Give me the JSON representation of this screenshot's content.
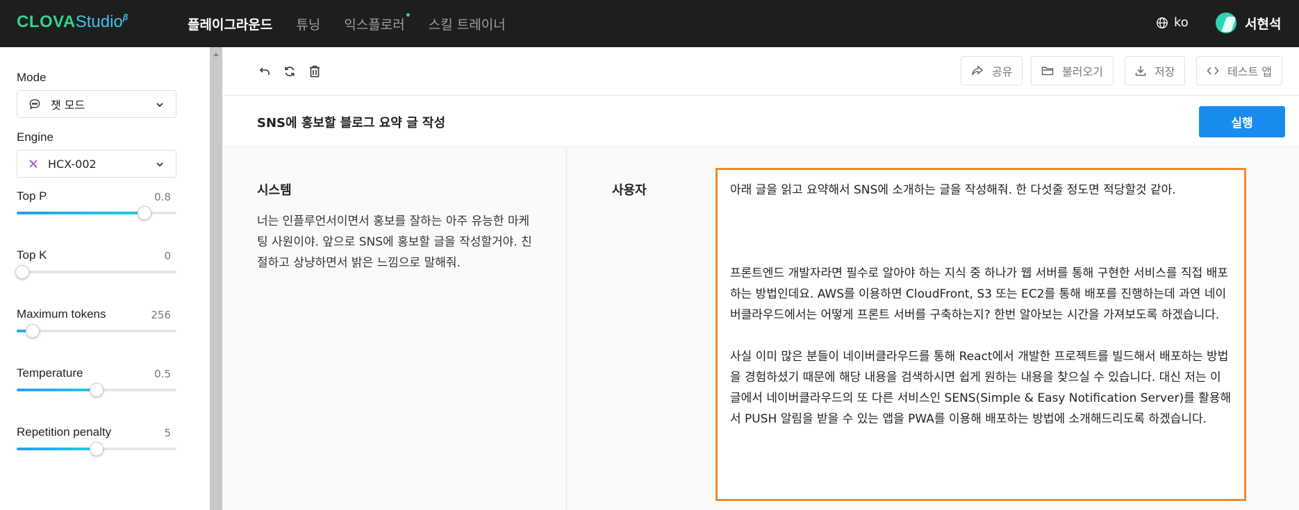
{
  "app": {
    "logo_main": "CLOVA",
    "logo_sub": "Studio",
    "logo_beta": "β"
  },
  "nav": {
    "items": [
      {
        "label": "플레이그라운드",
        "active": true
      },
      {
        "label": "튜닝",
        "active": false
      },
      {
        "label": "익스플로러",
        "active": false
      },
      {
        "label": "스킬 트레이너",
        "active": false
      }
    ],
    "language": "ko",
    "user_name": "서현석"
  },
  "sidebar": {
    "mode_label": "Mode",
    "mode_value": "챗 모드",
    "engine_label": "Engine",
    "engine_value": "HCX-002",
    "params": [
      {
        "label": "Top P",
        "value": "0.8",
        "fraction": 0.8
      },
      {
        "label": "Top K",
        "value": "0",
        "fraction": 0.0
      },
      {
        "label": "Maximum tokens",
        "value": "256",
        "fraction": 0.1
      },
      {
        "label": "Temperature",
        "value": "0.5",
        "fraction": 0.5
      },
      {
        "label": "Repetition penalty",
        "value": "5",
        "fraction": 0.5
      }
    ]
  },
  "toolbar": {
    "share": "공유",
    "load": "불러오기",
    "save": "저장",
    "test_app": "테스트 앱"
  },
  "main": {
    "title": "SNS에 홍보할 블로그 요약 글 작성",
    "run": "실행",
    "system_label": "시스템",
    "system_text": "너는 인플루언서이면서 홍보를 잘하는 아주 유능한 마케팅 사원이야. 앞으로 SNS에 홍보할 글을 작성할거야. 친절하고 상냥하면서 밝은 느낌으로 말해줘.",
    "user_label": "사용자",
    "user_text": "아래 글을 읽고 요약해서 SNS에 소개하는 글을 작성해줘. 한 다섯줄 정도면 적당할것 같아.\n\n\n\n프론트엔드 개발자라면 필수로 알아야 하는 지식 중 하나가 웹 서버를 통해 구현한 서비스를 직접 배포하는 방법인데요. AWS를 이용하면 CloudFront, S3 또는 EC2를 통해 배포를 진행하는데 과연 네이버클라우드에서는 어떻게 프론트 서버를 구축하는지? 한번 알아보는 시간을 가져보도록 하겠습니다.\n\n사실 이미 많은 분들이 네이버클라우드를 통해 React에서 개발한 프로젝트를 빌드해서 배포하는 방법을 경험하셨기 때문에 해당 내용을 검색하시면 쉽게 원하는 내용을 찾으실 수 있습니다. 대신 저는 이 글에서 네이버클라우드의 또 다른 서비스인 SENS(Simple & Easy Notification Server)를 활용해서 PUSH 알림을 받을 수 있는 앱을 PWA를 이용해 배포하는 방법에 소개해드리도록 하겠습니다."
  },
  "colors": {
    "topbar": "#1e1e1e",
    "accent_blue": "#1a8cf0",
    "highlight_orange": "#f08a30",
    "logo_green": "#2fd58f"
  }
}
